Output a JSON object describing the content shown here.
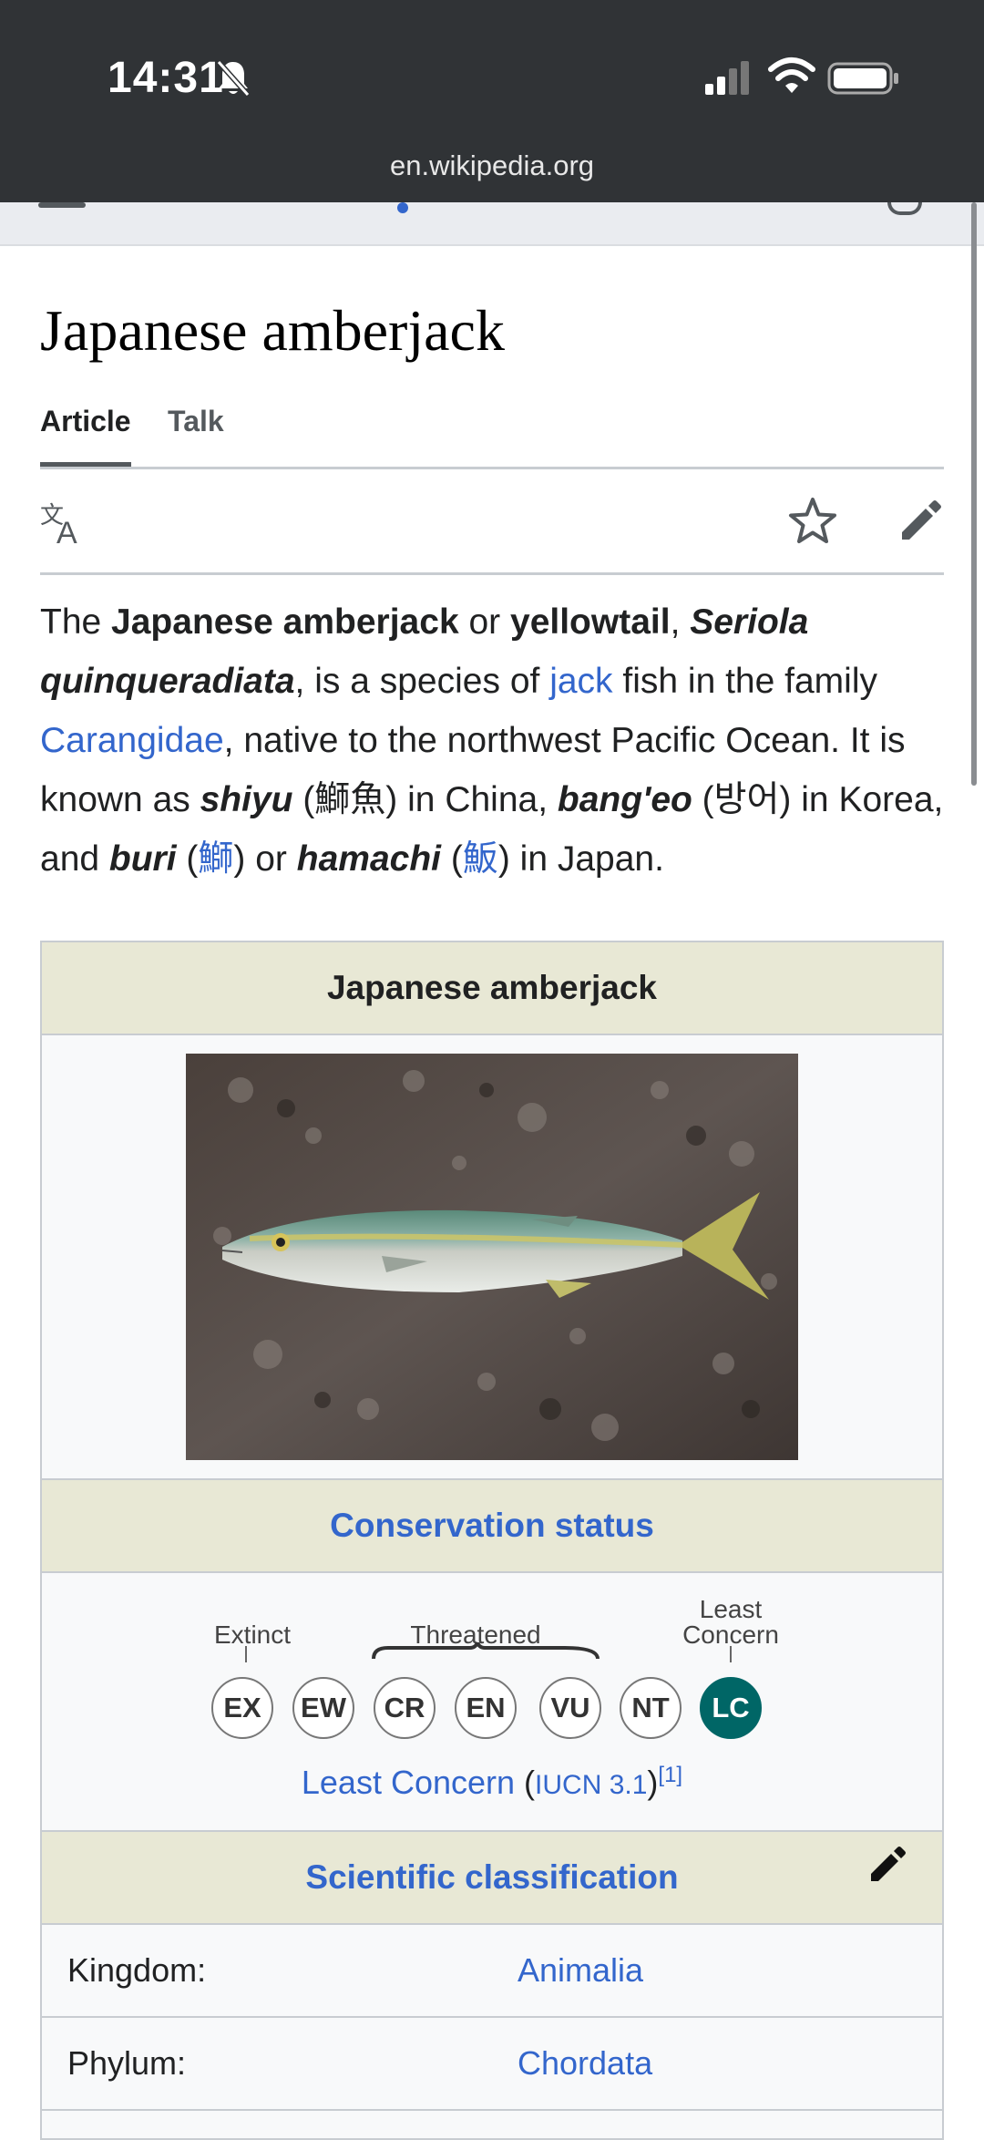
{
  "status_bar": {
    "time": "14:31",
    "url": "en.wikipedia.org"
  },
  "page": {
    "title": "Japanese amberjack",
    "tabs": [
      "Article",
      "Talk"
    ]
  },
  "lead": {
    "t1": "The ",
    "b1": "Japanese amberjack",
    "t2": " or ",
    "b2": "yellowtail",
    "t3": ", ",
    "bi1": "Seriola quinqueradiata",
    "t4": ", is a species of ",
    "link_jack": "jack",
    "t5": " fish in the family ",
    "link_carangidae": "Carangidae",
    "t6": ", native to the northwest Pacific Ocean. It is known as ",
    "bi2": "shiyu",
    "t7": " (鰤魚) in China, ",
    "bi3": "bang'eo",
    "t8": " (방어) in Korea, and ",
    "bi4": "buri",
    "t9": " (",
    "link_buri": "鰤",
    "t10": ") or ",
    "bi5": "hamachi",
    "t11": " (",
    "link_hamachi": "魬",
    "t12": ") in Japan."
  },
  "infobox": {
    "title": "Japanese amberjack",
    "conservation_header": "Conservation status",
    "labels": {
      "extinct": "Extinct",
      "threatened": "Threatened",
      "least": "Least",
      "concern": "Concern"
    },
    "statuses": [
      "EX",
      "EW",
      "CR",
      "EN",
      "VU",
      "NT",
      "LC"
    ],
    "status_link": "Least Concern",
    "status_open": " (",
    "status_source": "IUCN 3.1",
    "status_close": ")",
    "status_ref": "[1]",
    "classification_header": "Scientific classification",
    "rows": [
      {
        "key": "Kingdom:",
        "value": "Animalia"
      },
      {
        "key": "Phylum:",
        "value": "Chordata"
      }
    ]
  }
}
